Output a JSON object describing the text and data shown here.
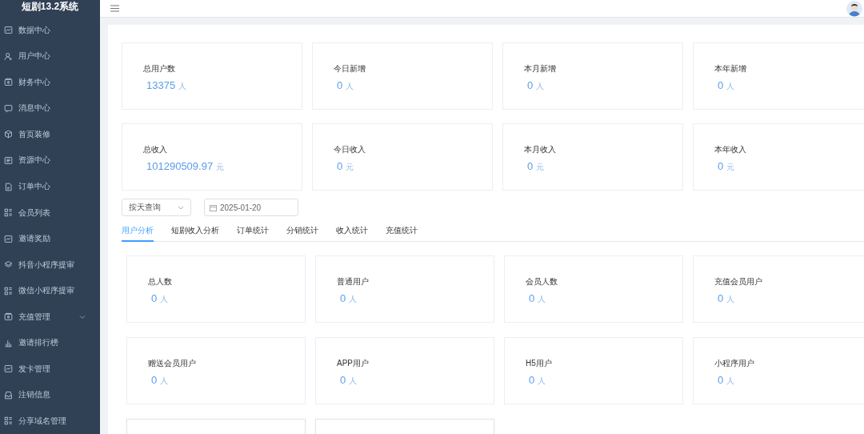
{
  "sidebar": {
    "title": "短剧13.2系统",
    "items": [
      {
        "label": "数据中心",
        "expandable": false
      },
      {
        "label": "用户中心",
        "expandable": false
      },
      {
        "label": "财务中心",
        "expandable": false
      },
      {
        "label": "消息中心",
        "expandable": false
      },
      {
        "label": "首页装修",
        "expandable": false
      },
      {
        "label": "资源中心",
        "expandable": false
      },
      {
        "label": "订单中心",
        "expandable": false
      },
      {
        "label": "会员列表",
        "expandable": false
      },
      {
        "label": "邀请奖励",
        "expandable": false
      },
      {
        "label": "抖音小程序提审",
        "expandable": false
      },
      {
        "label": "微信小程序提审",
        "expandable": false
      },
      {
        "label": "充值管理",
        "expandable": true
      },
      {
        "label": "邀请排行榜",
        "expandable": false
      },
      {
        "label": "发卡管理",
        "expandable": false
      },
      {
        "label": "注销信息",
        "expandable": false
      },
      {
        "label": "分享域名管理",
        "expandable": false
      }
    ]
  },
  "summary_cards": [
    {
      "label": "总用户数",
      "value": "13375",
      "unit": "人"
    },
    {
      "label": "今日新增",
      "value": "0",
      "unit": "人"
    },
    {
      "label": "本月新增",
      "value": "0",
      "unit": "人"
    },
    {
      "label": "本年新增",
      "value": "0",
      "unit": "人"
    },
    {
      "label": "总收入",
      "value": "101290509.97",
      "unit": "元"
    },
    {
      "label": "今日收入",
      "value": "0",
      "unit": "元"
    },
    {
      "label": "本月收入",
      "value": "0",
      "unit": "元"
    },
    {
      "label": "本年收入",
      "value": "0",
      "unit": "元"
    }
  ],
  "filters": {
    "query_mode": "按天查询",
    "date": "2025-01-20"
  },
  "tabs": [
    {
      "label": "用户分析",
      "selected": true
    },
    {
      "label": "短剧收入分析",
      "selected": false
    },
    {
      "label": "订单统计",
      "selected": false
    },
    {
      "label": "分销统计",
      "selected": false
    },
    {
      "label": "收入统计",
      "selected": false
    },
    {
      "label": "充值统计",
      "selected": false
    }
  ],
  "user_cards": [
    {
      "label": "总人数",
      "value": "0",
      "unit": "人"
    },
    {
      "label": "普通用户",
      "value": "0",
      "unit": "人"
    },
    {
      "label": "会员人数",
      "value": "0",
      "unit": "人"
    },
    {
      "label": "充值会员用户",
      "value": "0",
      "unit": "人"
    },
    {
      "label": "赠送会员用户",
      "value": "0",
      "unit": "人"
    },
    {
      "label": "APP用户",
      "value": "0",
      "unit": "人"
    },
    {
      "label": "H5用户",
      "value": "0",
      "unit": "人"
    },
    {
      "label": "小程序用户",
      "value": "0",
      "unit": "人"
    },
    {
      "kind": "empty"
    },
    {
      "kind": "empty"
    }
  ]
}
